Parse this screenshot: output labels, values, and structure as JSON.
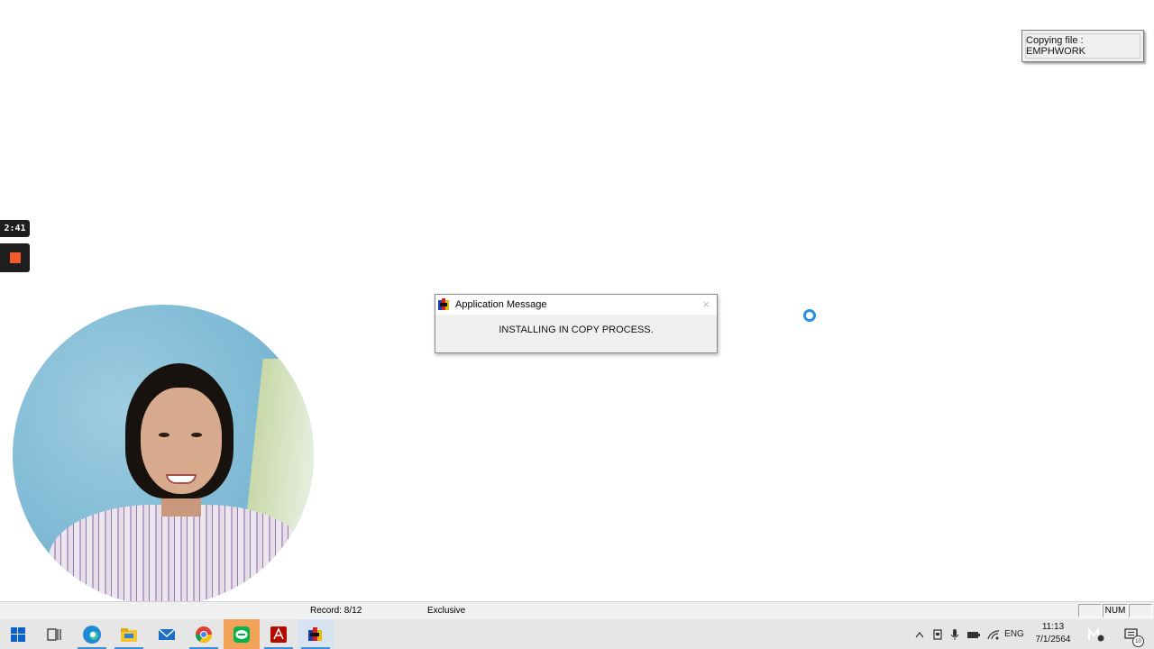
{
  "notification": {
    "text": "Copying file : EMPHWORK"
  },
  "recorder": {
    "time": "2:41"
  },
  "dialog": {
    "title": "Application Message",
    "message": "INSTALLING IN COPY PROCESS.",
    "close_glyph": "×",
    "icon": "app-logo-icon"
  },
  "statusbar": {
    "record": "Record: 8/12",
    "mode": "Exclusive",
    "num": "NUM"
  },
  "taskbar": {
    "apps": [
      "start-icon",
      "task-view-icon",
      "edge-icon",
      "file-explorer-icon",
      "mail-icon",
      "chrome-icon",
      "line-icon",
      "acrobat-icon",
      "app-logo-icon"
    ],
    "language": "ENG",
    "time": "11:13",
    "date": "7/1/2564",
    "notification_count": "10"
  },
  "colors": {
    "accent": "#3b8ed8",
    "stop": "#f25a2a",
    "highlight": "#f4a25a"
  }
}
